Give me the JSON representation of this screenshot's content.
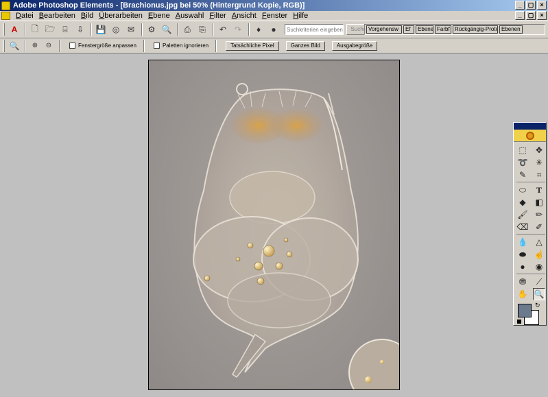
{
  "titlebar": {
    "title": "Adobe Photoshop Elements - [Brachionus.jpg bei 50% (Hintergrund Kopie, RGB)]",
    "minimize": "_",
    "maximize": "▢",
    "close": "×"
  },
  "menubar": {
    "items": [
      "Datei",
      "Bearbeiten",
      "Bild",
      "Überarbeiten",
      "Ebene",
      "Auswahl",
      "Filter",
      "Ansicht",
      "Fenster",
      "Hilfe"
    ]
  },
  "toolbar": {
    "search_placeholder": "Suchkriterien eingeben",
    "search_button": "Suchen",
    "help_icon": "?",
    "palette_tabs": [
      "Vorgehensw",
      "Ef",
      "Ebenen",
      "Farbf",
      "Rückgängig-Proto",
      "Ebenen"
    ]
  },
  "options": {
    "resize_windows": "Fenstergröße anpassen",
    "ignore_palettes": "Paletten ignorieren",
    "actual_pixels": "Tatsächliche Pixel",
    "fit_on_screen": "Ganzes Bild",
    "print_size": "Ausgabegröße"
  },
  "toolbox": {
    "active_tool": "zoom-tool",
    "foreground_color": "#6b7a8c",
    "background_color": "#ffffff"
  },
  "colors": {
    "titlebar_start": "#0a246a",
    "chrome": "#d4d0c8",
    "workspace": "#c0c0c0"
  }
}
